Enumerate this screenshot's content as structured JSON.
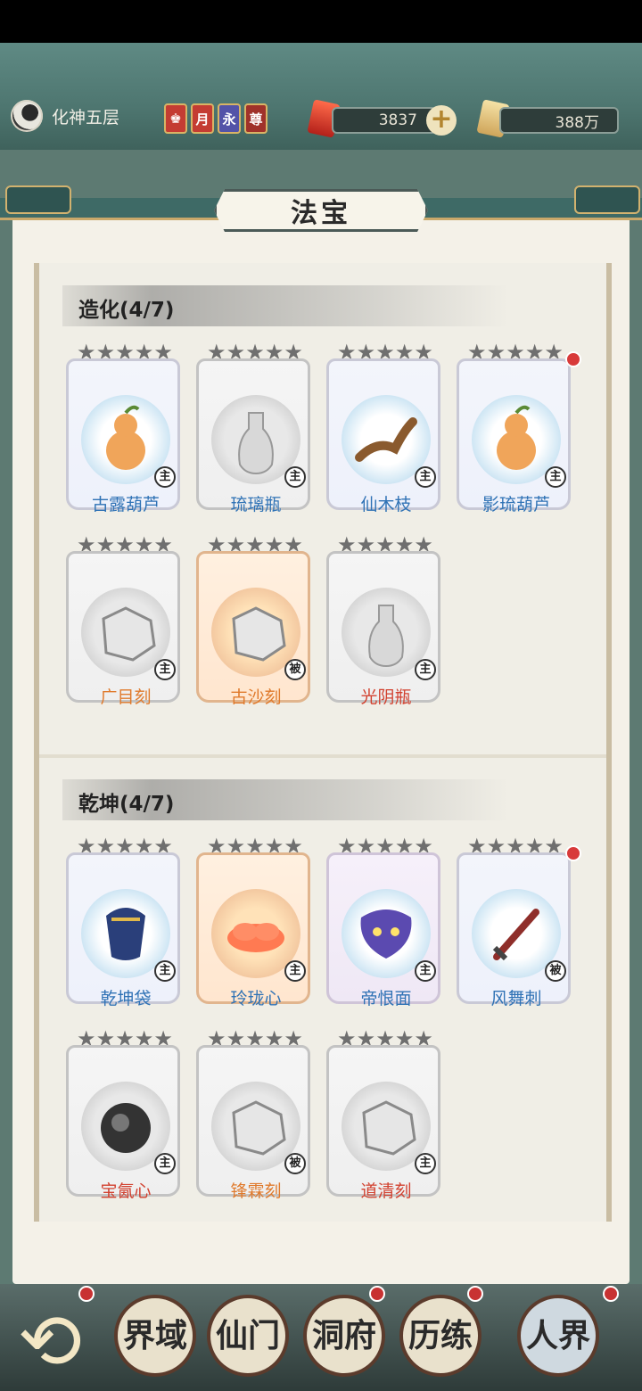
{
  "header": {
    "realm": "化神五层",
    "badges": [
      {
        "label": "♚",
        "color": "#c43c33"
      },
      {
        "label": "月",
        "color": "#c43c33"
      },
      {
        "label": "永",
        "color": "#5353a8"
      },
      {
        "label": "尊",
        "color": "#a0322a"
      }
    ],
    "currency_1": "3837",
    "currency_2": "388万",
    "plus_label": "+"
  },
  "page_title": "法宝",
  "sections": [
    {
      "title": "造化(4/7)",
      "items": [
        {
          "name": "古露葫芦",
          "tag": "主",
          "color": "blue",
          "icon": "gourd-icon"
        },
        {
          "name": "琉璃瓶",
          "tag": "主",
          "color": "blue",
          "icon": "bottle-icon"
        },
        {
          "name": "仙木枝",
          "tag": "主",
          "color": "blue",
          "icon": "branch-icon"
        },
        {
          "name": "影琉葫芦",
          "tag": "主",
          "color": "blue",
          "icon": "gourd-icon",
          "dot": true
        },
        {
          "name": "广目刻",
          "tag": "主",
          "color": "orange",
          "icon": "rock-icon"
        },
        {
          "name": "古沙刻",
          "tag": "被",
          "color": "orange",
          "icon": "rock-icon"
        },
        {
          "name": "光阴瓶",
          "tag": "主",
          "color": "red",
          "icon": "bottle-icon"
        }
      ]
    },
    {
      "title": "乾坤(4/7)",
      "items": [
        {
          "name": "乾坤袋",
          "tag": "主",
          "color": "blue",
          "icon": "bag-icon"
        },
        {
          "name": "玲珑心",
          "tag": "主",
          "color": "blue",
          "icon": "cloud-icon"
        },
        {
          "name": "帝恨面",
          "tag": "主",
          "color": "blue",
          "icon": "mask-icon"
        },
        {
          "name": "风舞刺",
          "tag": "被",
          "color": "blue",
          "icon": "sword-icon",
          "dot": true
        },
        {
          "name": "宝氤心",
          "tag": "主",
          "color": "red",
          "icon": "smoke-icon"
        },
        {
          "name": "锋霖刻",
          "tag": "被",
          "color": "orange",
          "icon": "rock-icon"
        },
        {
          "name": "道清刻",
          "tag": "主",
          "color": "red",
          "icon": "rock-icon"
        }
      ]
    }
  ],
  "bottom_nav": [
    {
      "label": "界域",
      "icon": "realm-icon"
    },
    {
      "label": "仙门",
      "icon": "sect-icon"
    },
    {
      "label": "洞府",
      "icon": "cave-icon"
    },
    {
      "label": "历练",
      "icon": "trial-icon"
    },
    {
      "label": "人界",
      "icon": "world-icon"
    }
  ],
  "stars": "★"
}
